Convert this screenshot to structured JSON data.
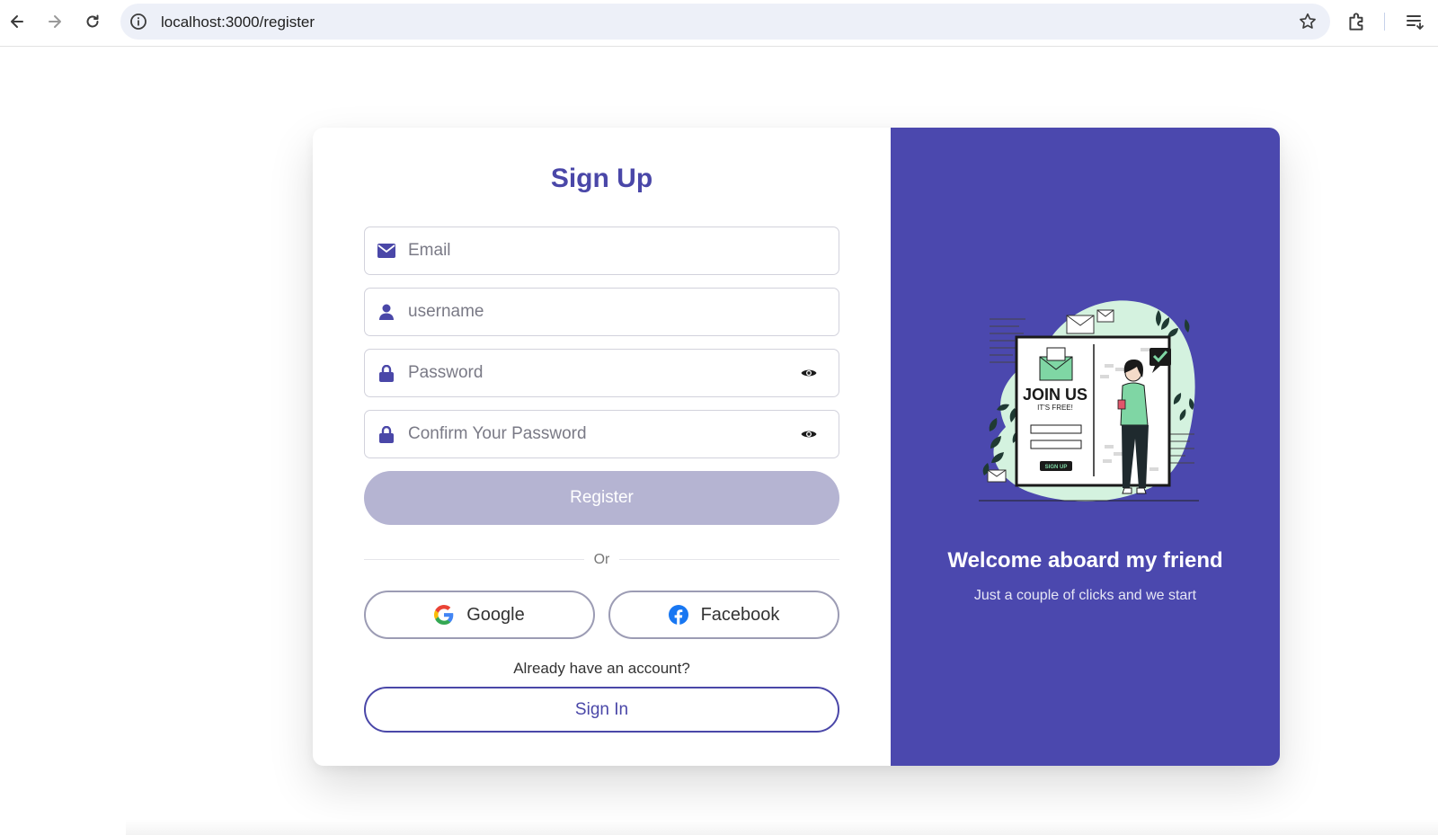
{
  "browser": {
    "url": "localhost:3000/register"
  },
  "form": {
    "title": "Sign Up",
    "email_placeholder": "Email",
    "username_placeholder": "username",
    "password_placeholder": "Password",
    "confirm_placeholder": "Confirm Your Password",
    "register_label": "Register",
    "or_label": "Or",
    "google_label": "Google",
    "facebook_label": "Facebook",
    "already_text": "Already have an account?",
    "signin_label": "Sign In"
  },
  "promo": {
    "title": "Welcome aboard my friend",
    "subtitle": "Just a couple of clicks and we start",
    "illustration": {
      "heading": "JOIN US",
      "subheading": "IT'S FREE!",
      "button": "SIGN UP"
    }
  },
  "colors": {
    "brand": "#4b48ae",
    "register_disabled": "#b5b4d2",
    "illustration_accent": "#7fd6a4"
  }
}
